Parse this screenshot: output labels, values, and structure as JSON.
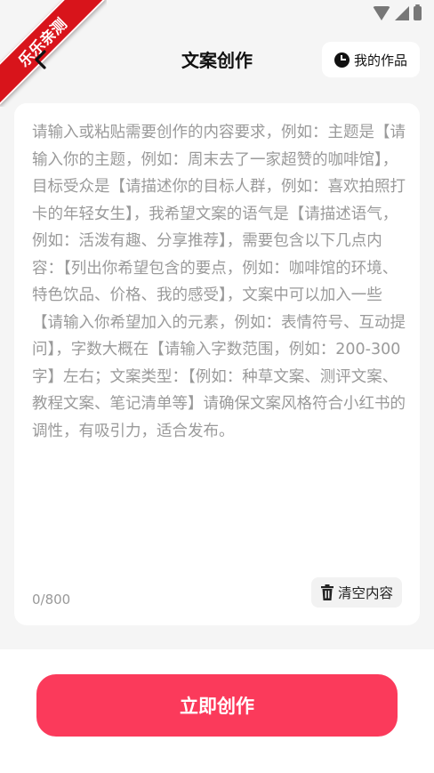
{
  "watermark": {
    "text": "乐乐亲测"
  },
  "header": {
    "title": "文案创作",
    "my_works_label": "我的作品"
  },
  "editor": {
    "placeholder": "请输入或粘贴需要创作的内容要求，例如：主题是【请输入你的主题，例如：周末去了一家超赞的咖啡馆】，目标受众是【请描述你的目标人群，例如：喜欢拍照打卡的年轻女生】，我希望文案的语气是【请描述语气，例如：活泼有趣、分享推荐】，需要包含以下几点内容：【列出你希望包含的要点，例如：咖啡馆的环境、特色饮品、价格、我的感受】，文案中可以加入一些【请输入你希望加入的元素，例如：表情符号、互动提问】，字数大概在【请输入字数范围，例如：200-300字】左右；文案类型：【例如：种草文案、测评文案、教程文案、笔记清单等】请确保文案风格符合小红书的调性，有吸引力，适合发布。",
    "value": "",
    "char_count": "0/800",
    "clear_label": "清空内容"
  },
  "actions": {
    "create_label": "立即创作"
  },
  "colors": {
    "accent": "#fb3a5b",
    "ribbon": "#d8141b"
  }
}
